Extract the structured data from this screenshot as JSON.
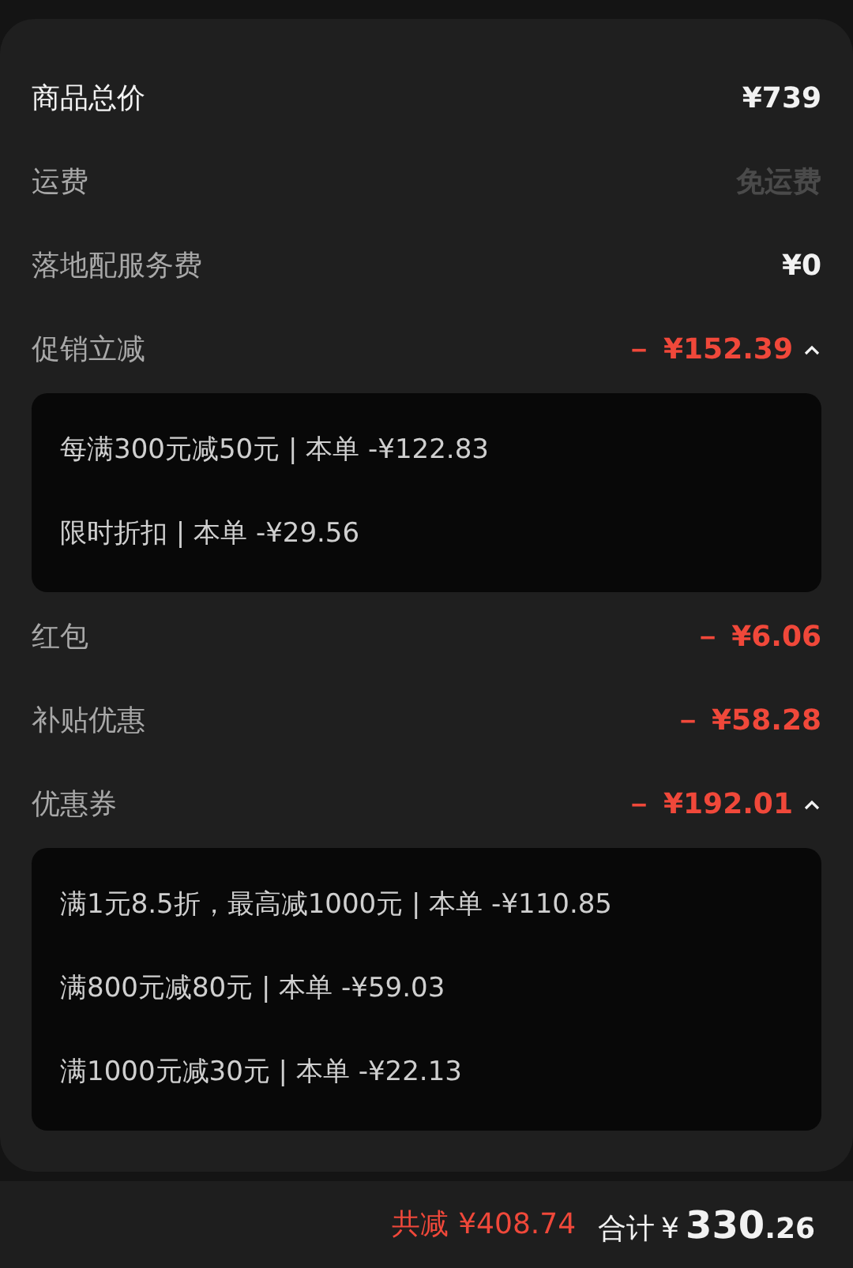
{
  "rows": [
    {
      "label": "商品总价",
      "value": "¥739",
      "color": "#f2f2f2",
      "emphasis": true
    },
    {
      "label": "运费",
      "value": "免运费",
      "color": "#4a4a4a",
      "emphasis": false
    },
    {
      "label": "落地配服务费",
      "value": "¥0",
      "color": "#f2f2f2",
      "emphasis": false
    },
    {
      "label": "促销立减",
      "value": "－ ¥152.39",
      "color": "#f0483a",
      "emphasis": false,
      "expanded": true,
      "details": [
        "每满300元减50元 | 本单 -¥122.83",
        "限时折扣 | 本单 -¥29.56"
      ]
    },
    {
      "label": "红包",
      "value": "－ ¥6.06",
      "color": "#f0483a",
      "emphasis": false
    },
    {
      "label": "补贴优惠",
      "value": "－ ¥58.28",
      "color": "#f0483a",
      "emphasis": false
    },
    {
      "label": "优惠券",
      "value": "－ ¥192.01",
      "color": "#f0483a",
      "emphasis": false,
      "expanded": true,
      "details": [
        "满1元8.5折，最高减1000元 | 本单 -¥110.85",
        "满800元减80元 | 本单 -¥59.03",
        "满1000元减30元 | 本单 -¥22.13"
      ]
    }
  ],
  "footer": {
    "saved_label": "共减",
    "saved_value": "¥408.74",
    "total_label": "合计",
    "currency": "¥",
    "integer": "330",
    "decimal": ".26"
  }
}
